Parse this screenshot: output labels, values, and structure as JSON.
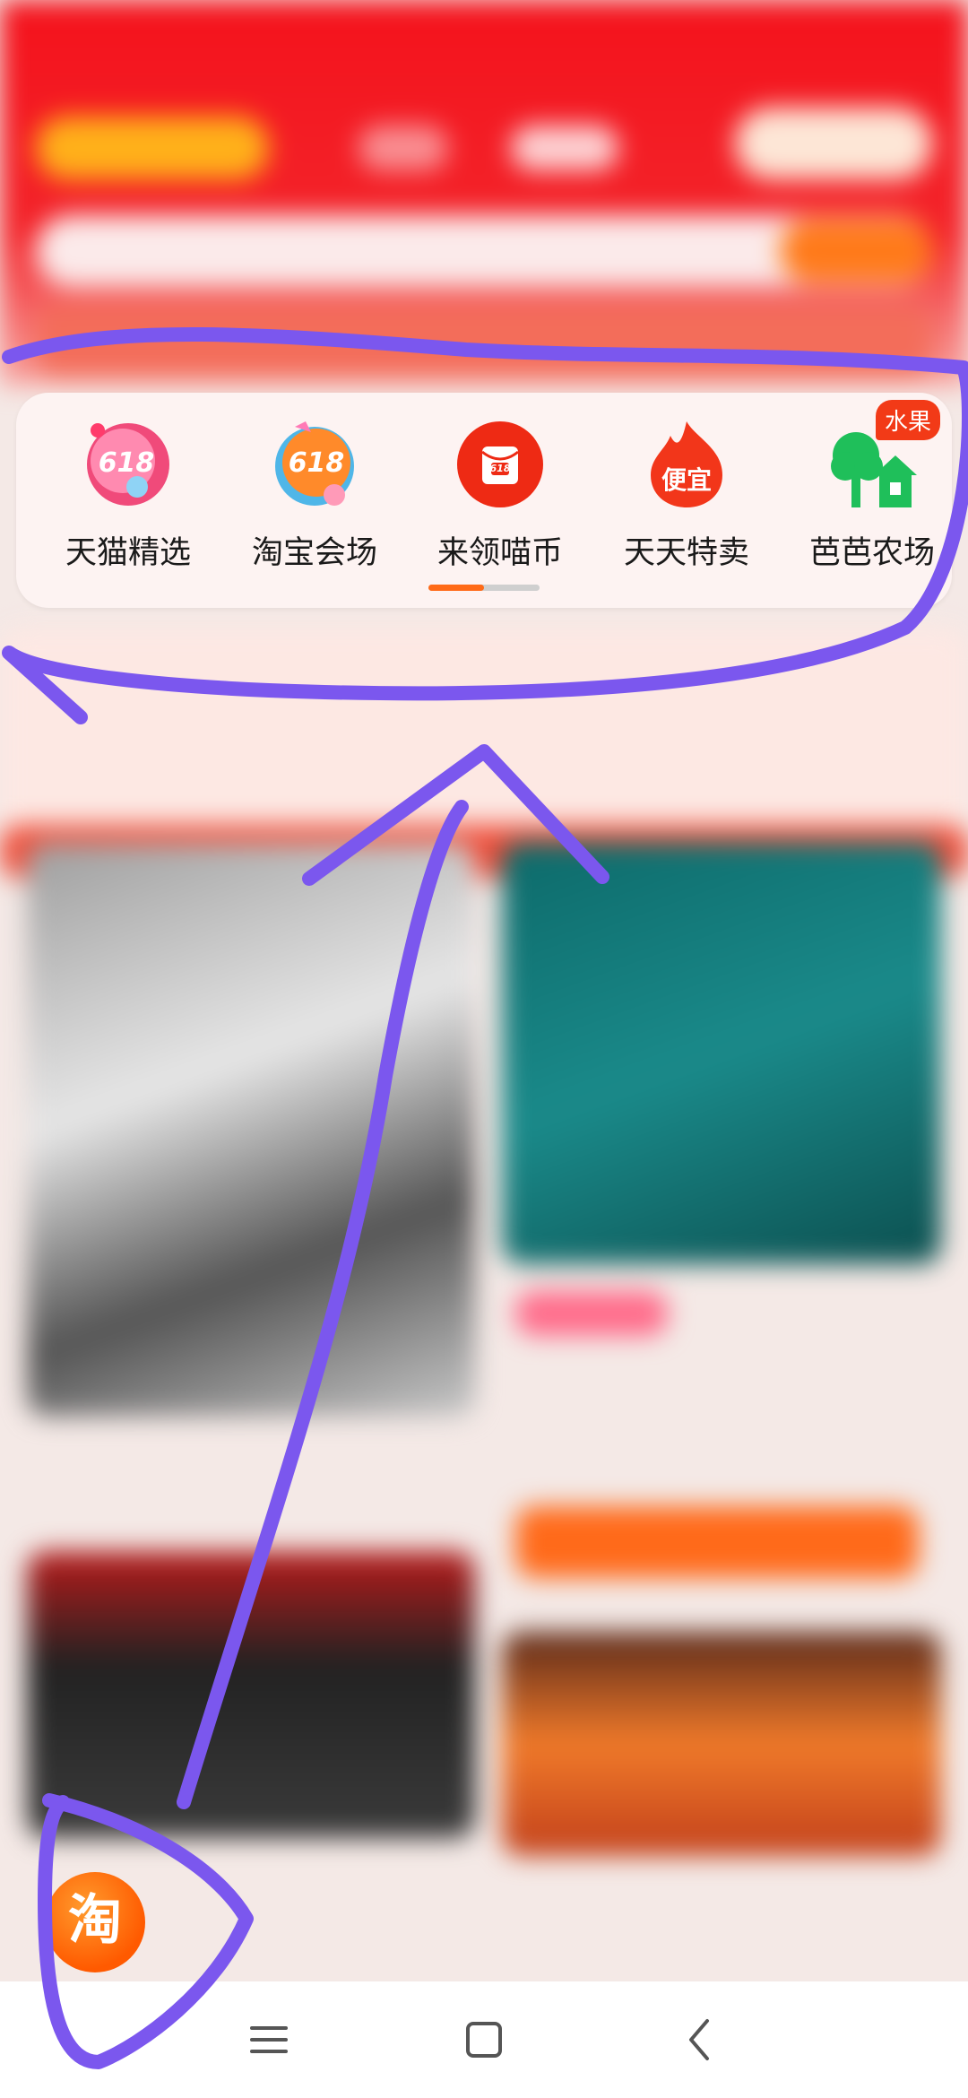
{
  "icon_bar": {
    "items": [
      {
        "label": "天猫精选",
        "icon": "tmall-618-icon"
      },
      {
        "label": "淘宝会场",
        "icon": "taobao-618-icon"
      },
      {
        "label": "来领喵币",
        "icon": "red-envelope-618-icon",
        "icon_text": "618"
      },
      {
        "label": "天天特卖",
        "icon": "flame-cheap-icon",
        "icon_text": "便宜"
      },
      {
        "label": "芭芭农场",
        "icon": "tree-house-icon",
        "badge": "水果"
      }
    ],
    "scroll_progress": 0.5
  },
  "floating": {
    "taobao_logo_text": "淘"
  },
  "colors": {
    "accent": "#ff6a17",
    "annotation": "#7b57ee",
    "brand_red": "#f4121c"
  }
}
